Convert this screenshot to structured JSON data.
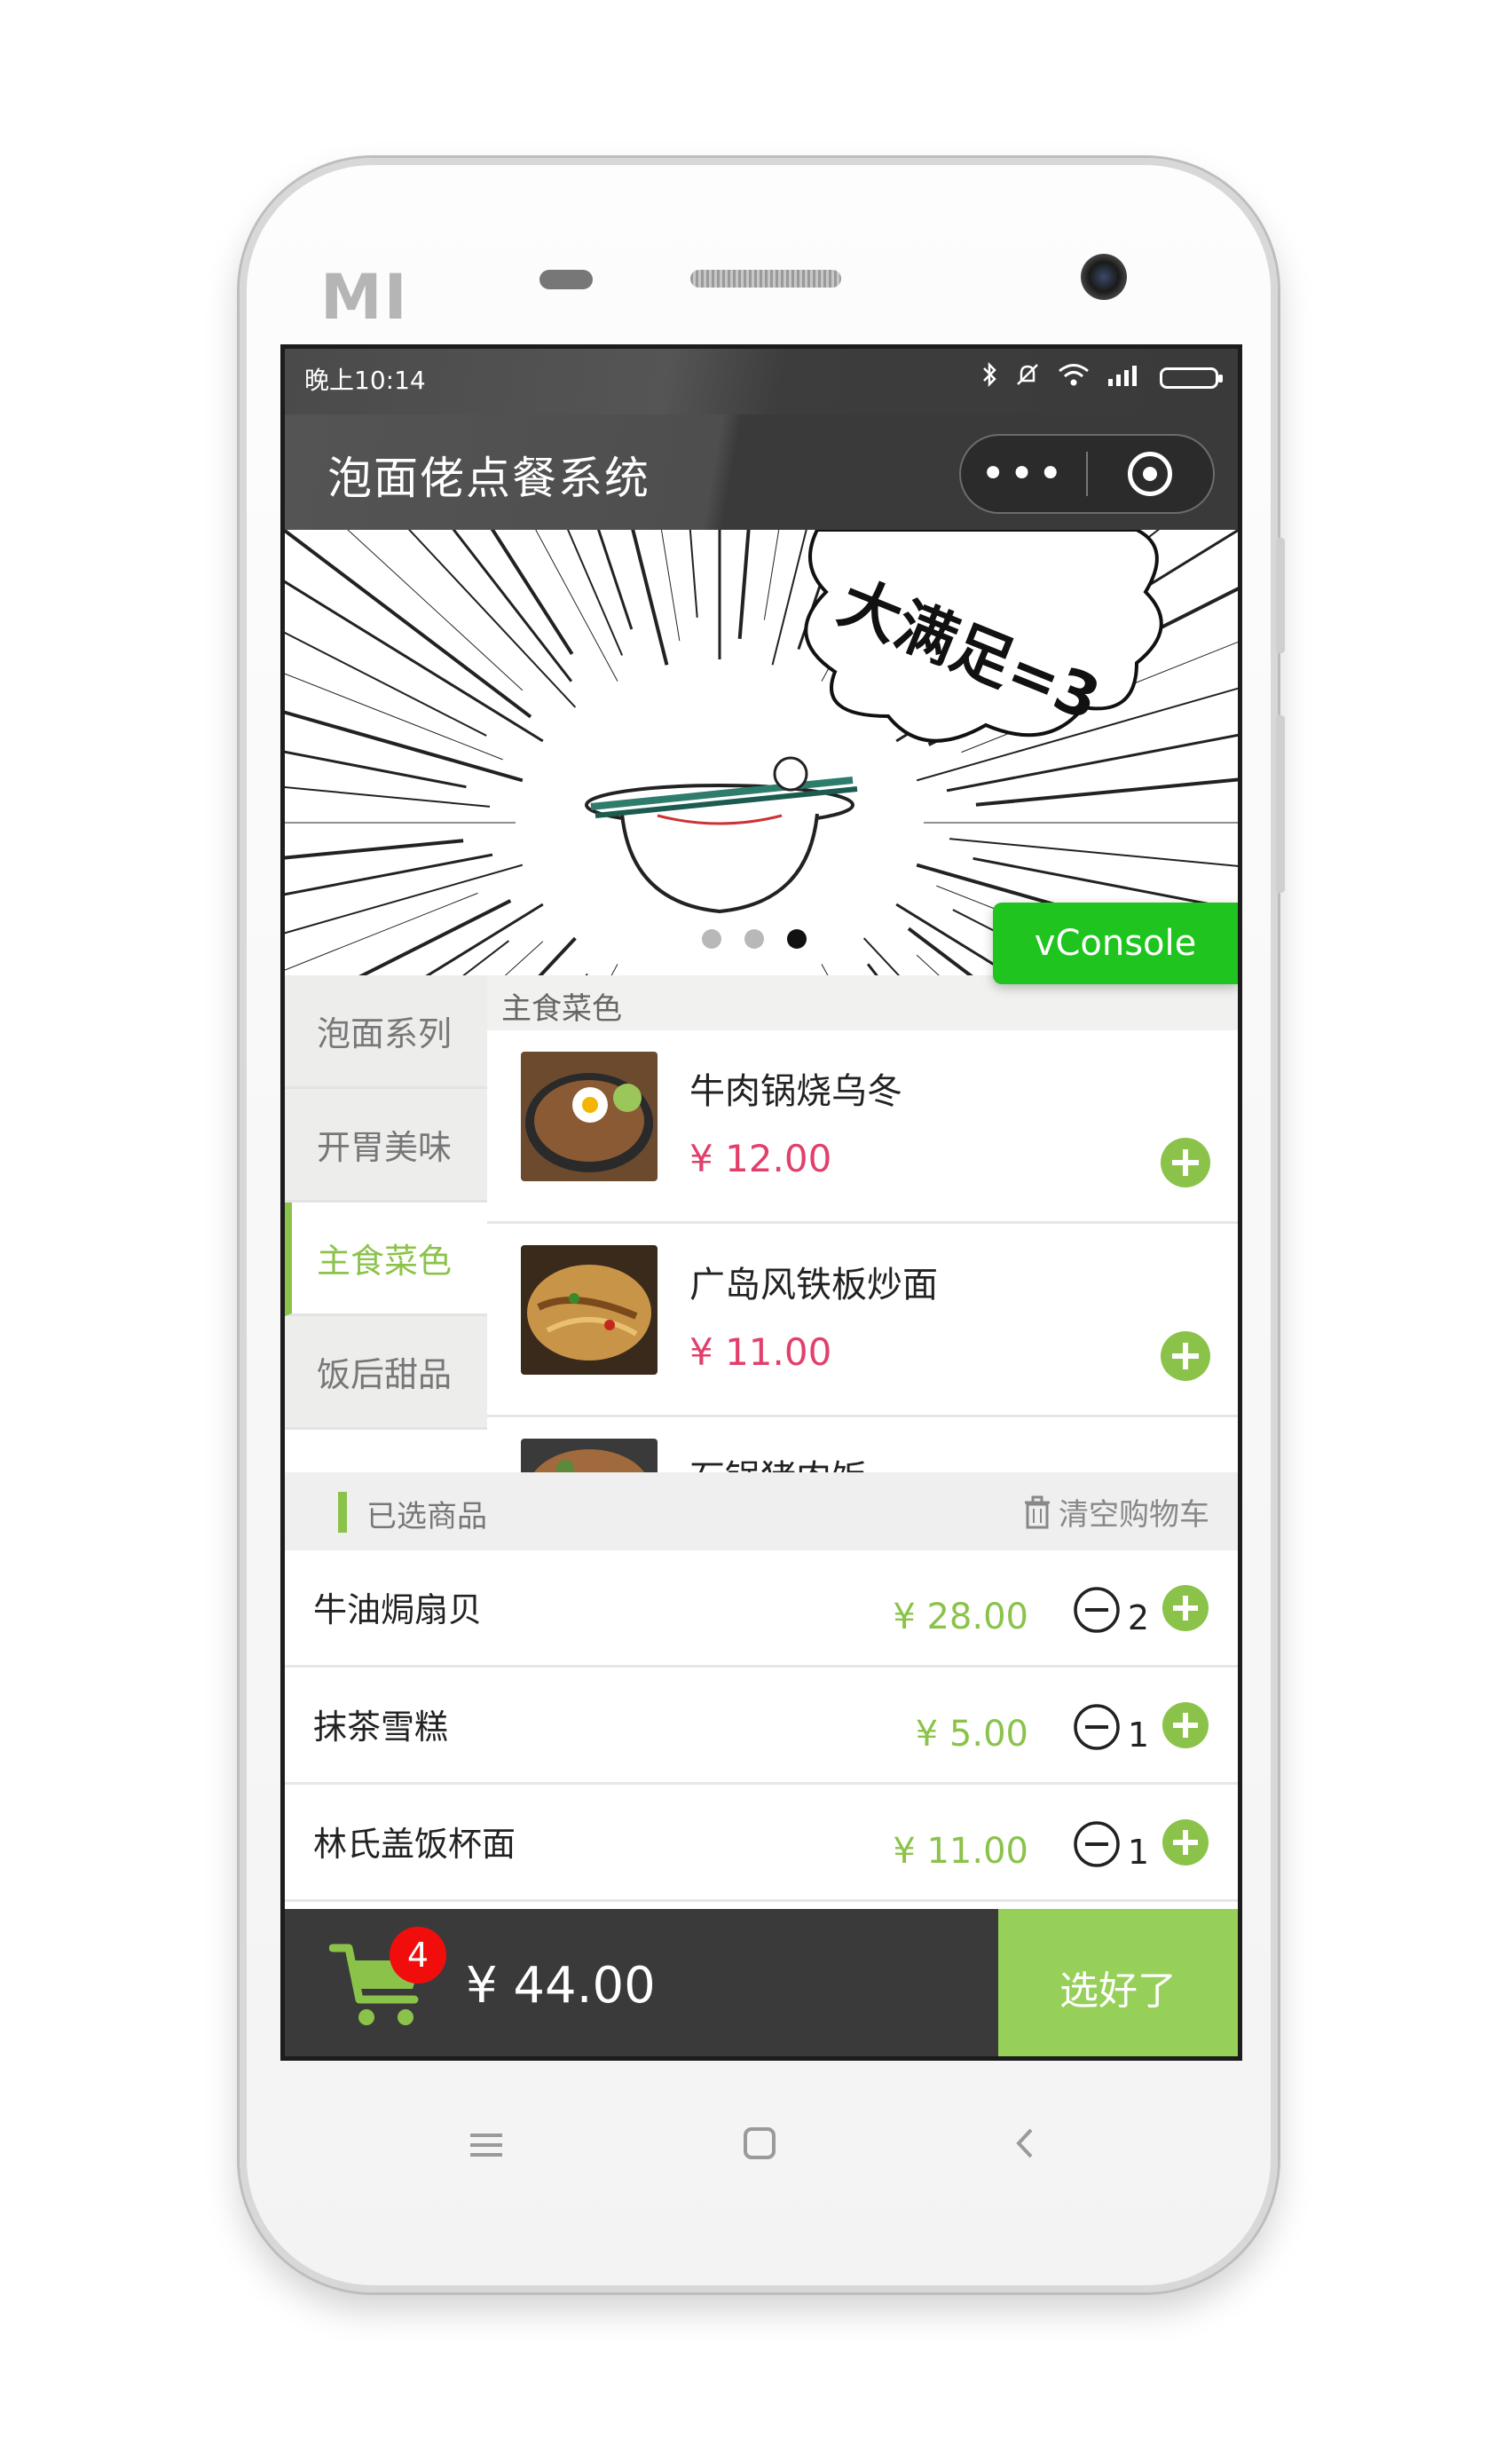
{
  "device": {
    "brand_logo": "MI"
  },
  "status_bar": {
    "time": "晚上10:14"
  },
  "nav_bar": {
    "title": "泡面佬点餐系统",
    "more_icon": "more-dots-icon",
    "close_icon": "target-icon"
  },
  "banner": {
    "caption": "大满足=3",
    "page_count": 3,
    "active_page": 3
  },
  "vconsole": {
    "label": "vConsole"
  },
  "categories": [
    {
      "label": "泡面系列",
      "active": false
    },
    {
      "label": "开胃美味",
      "active": false
    },
    {
      "label": "主食菜色",
      "active": true
    },
    {
      "label": "饭后甜品",
      "active": false
    }
  ],
  "menu": {
    "section_title": "主食菜色",
    "items": [
      {
        "name": "牛肉锅烧乌冬",
        "price": "¥ 12.00"
      },
      {
        "name": "广岛风铁板炒面",
        "price": "¥ 11.00"
      },
      {
        "name": "石锅猪肉饭",
        "price": ""
      }
    ]
  },
  "cart": {
    "title": "已选商品",
    "clear_label": "清空购物车",
    "items": [
      {
        "name": "牛油焗扇贝",
        "price": "¥ 28.00",
        "qty": "2"
      },
      {
        "name": "抹茶雪糕",
        "price": "¥ 5.00",
        "qty": "1"
      },
      {
        "name": "林氏盖饭杯面",
        "price": "¥ 11.00",
        "qty": "1"
      }
    ],
    "badge_count": "4",
    "total": "¥ 44.00",
    "checkout_label": "选好了"
  },
  "colors": {
    "accent_green": "#8bc34a",
    "price_red": "#e2406b",
    "dark_bar": "#3a3a3a",
    "vconsole_green": "#1fc41f"
  }
}
